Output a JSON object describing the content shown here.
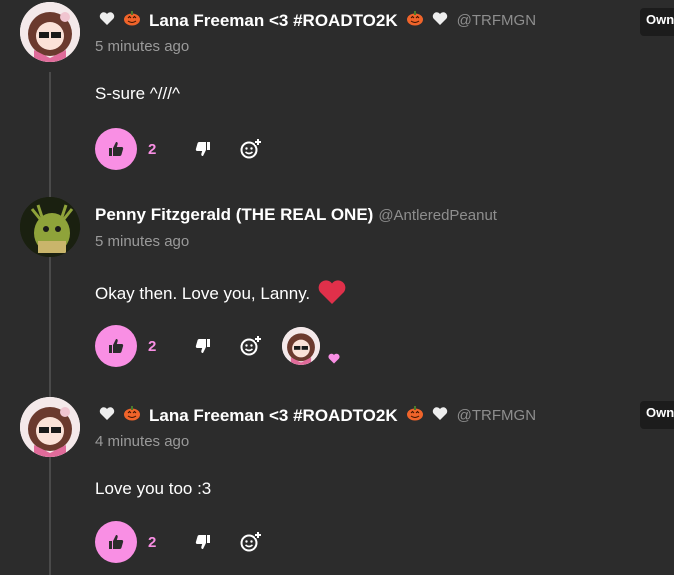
{
  "comments": [
    {
      "author": "Lana Freeman <3 #ROADTO2K",
      "handle": "@TRFMGN",
      "time": "5 minutes ago",
      "text": "S-sure ^///^",
      "likes": "2",
      "badge": "Owner"
    },
    {
      "author": "Penny Fitzgerald (THE REAL ONE)",
      "handle": "@AntleredPeanut",
      "time": "5 minutes ago",
      "text": "Okay then. Love you, Lanny.",
      "likes": "2"
    },
    {
      "author": "Lana Freeman <3 #ROADTO2K",
      "handle": "@TRFMGN",
      "time": "4 minutes ago",
      "text": "Love you too :3",
      "likes": "2",
      "badge": "Owner"
    }
  ],
  "colors": {
    "accent": "#f98fe4",
    "heart": "#e0304a",
    "background": "#2c2c2c"
  },
  "icons": [
    "white-heart-icon",
    "pumpkin-icon",
    "thumbs-up-icon",
    "thumbs-down-icon",
    "add-reaction-icon",
    "pink-heart-icon"
  ]
}
